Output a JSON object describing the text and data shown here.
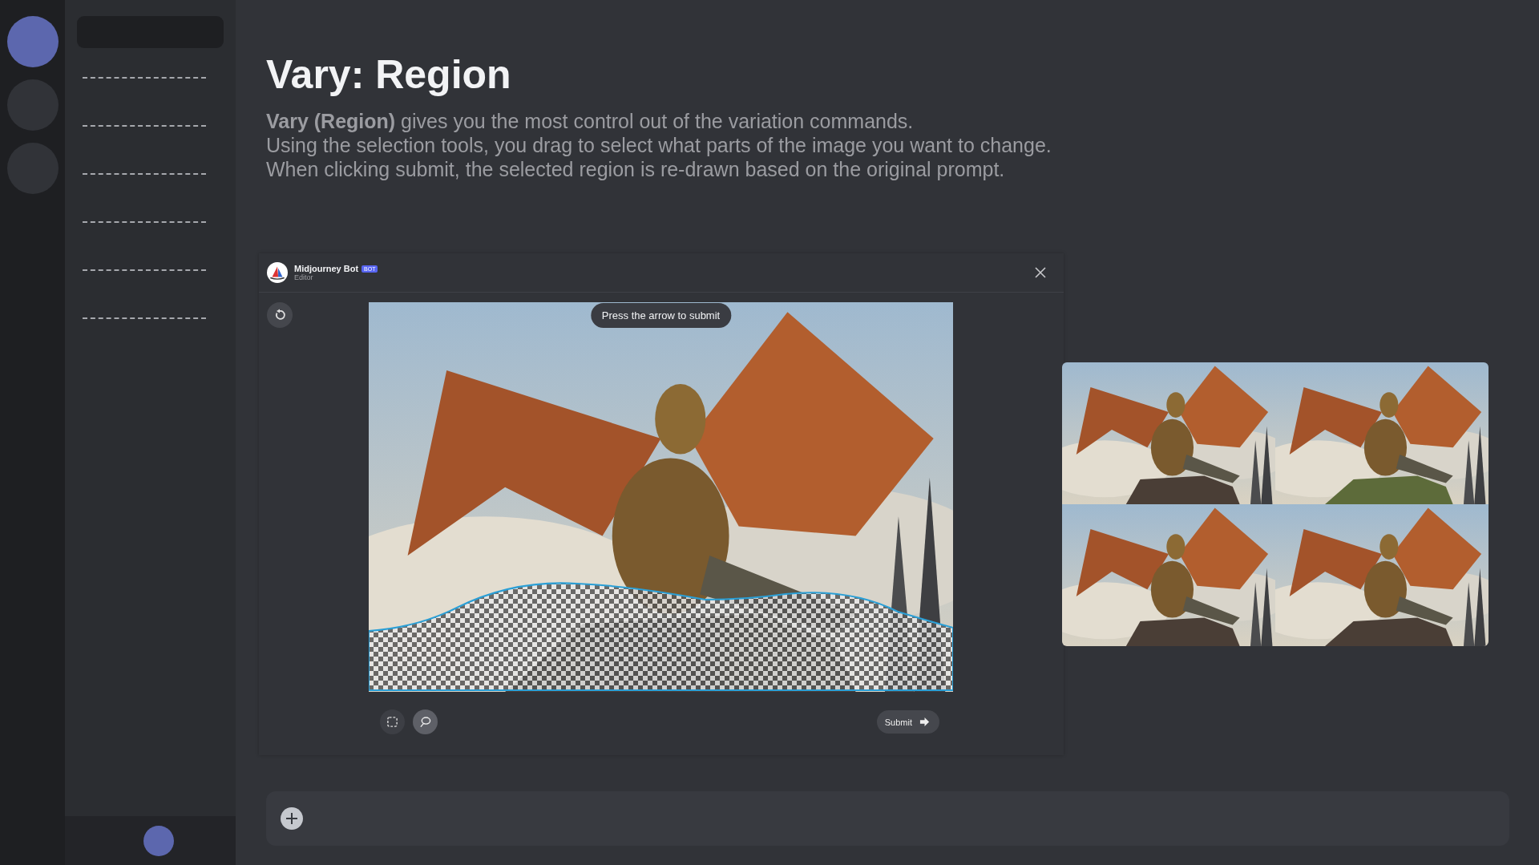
{
  "servers": [
    {
      "selected": true
    },
    {
      "selected": false
    },
    {
      "selected": false
    }
  ],
  "channels": [
    {
      "kind": "placeholder"
    },
    {
      "kind": "placeholder"
    },
    {
      "kind": "placeholder"
    },
    {
      "kind": "placeholder"
    },
    {
      "kind": "placeholder"
    },
    {
      "kind": "placeholder"
    }
  ],
  "heading": "Vary: Region",
  "description": [
    "**Vary (Region)** gives you the most control out of the variation commands.",
    "Using the selection tools, you drag to select what parts of the image you want to change.",
    "When clicking submit, the selected region is re-drawn based on the original prompt."
  ],
  "editor": {
    "bot_name": "Midjourney Bot",
    "badge": "BOT",
    "subtitle": "Editor",
    "image": {
      "kind": "picture"
    },
    "tooltip": "Press the arrow to submit",
    "tools": [
      {
        "kind": "rectangle",
        "selected": false
      },
      {
        "kind": "lasso",
        "selected": true
      }
    ],
    "submit": "Submit"
  },
  "variations": [
    {
      "kind": "picture"
    },
    {
      "kind": "picture"
    },
    {
      "kind": "picture"
    },
    {
      "kind": "picture"
    }
  ]
}
